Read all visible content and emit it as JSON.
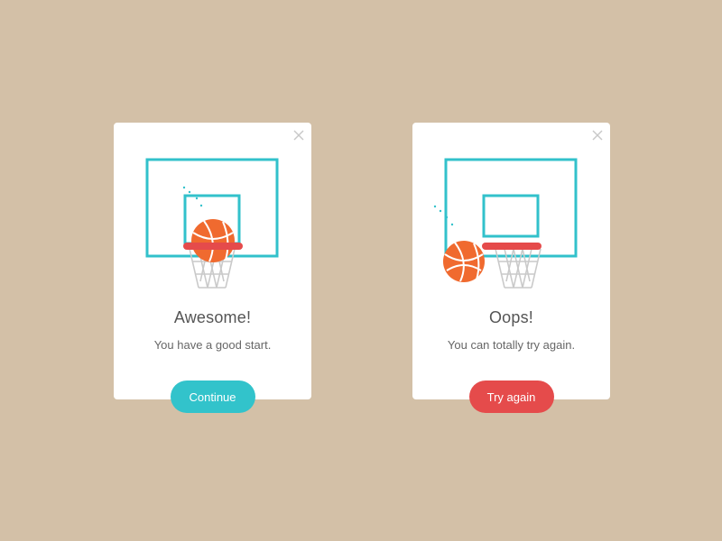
{
  "colors": {
    "background": "#D3C0A7",
    "card": "#FFFFFF",
    "backboard": "#32C1CB",
    "rim": "#E54B4B",
    "ball": "#F06A2F",
    "ball_seam": "#FFFFFF",
    "net": "#C9C9C9",
    "close_icon": "#C8C8C8",
    "continue_button": "#32C3CB",
    "retry_button": "#E54B4B",
    "title_text": "#555555",
    "message_text": "#666666"
  },
  "dialogs": [
    {
      "state": "success",
      "title": "Awesome!",
      "message": "You have a good start.",
      "button_label": "Continue",
      "close_icon": "close-icon"
    },
    {
      "state": "failure",
      "title": "Oops!",
      "message": "You can totally try again.",
      "button_label": "Try again",
      "close_icon": "close-icon"
    }
  ]
}
